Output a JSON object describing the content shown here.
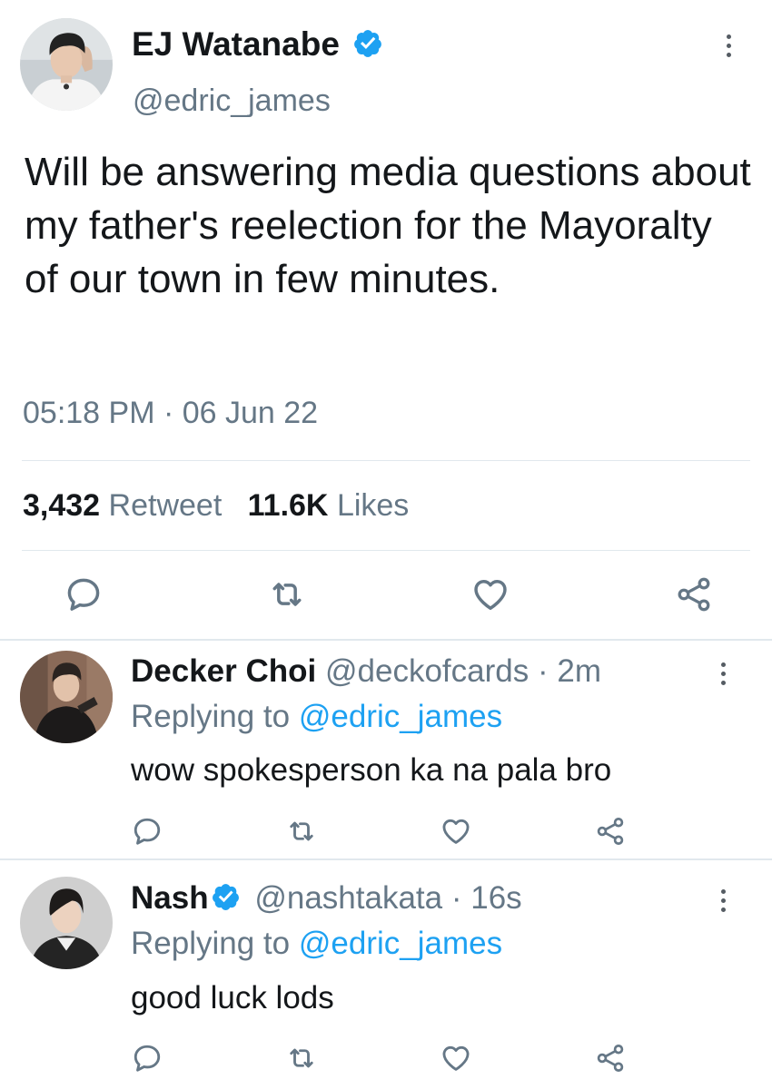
{
  "main_tweet": {
    "author_name": "EJ Watanabe",
    "handle": "@edric_james",
    "text": "Will be answering media questions about my father's reelection for the Mayoralty of our town in few minutes.",
    "timestamp": "05:18 PM · 06 Jun 22",
    "retweet_count": "3,432",
    "retweet_label": "Retweet",
    "likes_count": "11.6K",
    "likes_label": "Likes",
    "verified": true
  },
  "replies": [
    {
      "author_name": "Decker Choi",
      "handle": "@deckofcards",
      "separator": "·",
      "time": "2m",
      "replying_prefix": "Replying to",
      "replying_to": "@edric_james",
      "text": "wow spokesperson ka na pala bro",
      "verified": false
    },
    {
      "author_name": "Nash",
      "handle": "@nashtakata",
      "separator": "·",
      "time": "16s",
      "replying_prefix": "Replying to",
      "replying_to": "@edric_james",
      "text": "good luck lods",
      "verified": true
    }
  ],
  "icons": [
    "comment-icon",
    "retweet-icon",
    "like-icon",
    "share-icon",
    "more-icon",
    "verified-badge-icon"
  ],
  "colors": {
    "text_primary": "#14171a",
    "text_secondary": "#657786",
    "accent": "#1da1f2",
    "divider": "#e1e8ed"
  }
}
